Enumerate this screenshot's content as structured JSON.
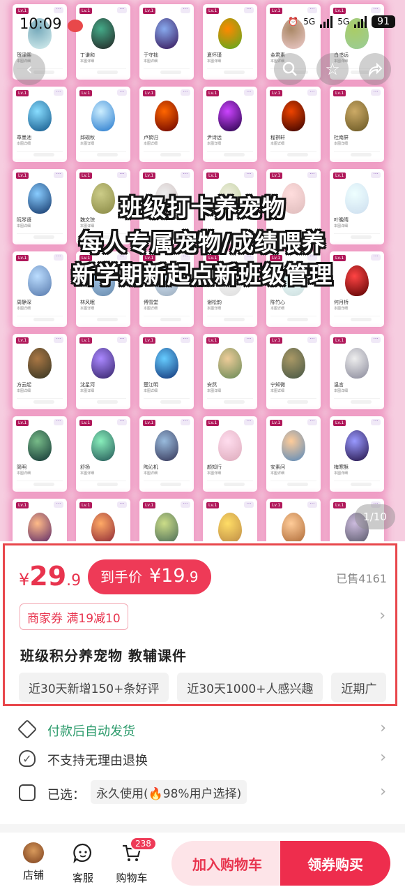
{
  "status_bar": {
    "time": "10:09",
    "net1": "5G",
    "net2": "5G",
    "battery": "91"
  },
  "gallery": {
    "overlay_lines": [
      "班级打卡养宠物",
      "每人专属宠物/成绩喂养",
      "新学期新起点新班级管理"
    ],
    "counter": "1/10",
    "card_level": "Lv.1",
    "card_subtitle": "本图详细",
    "names": [
      "贺泽熙",
      "丁谦和",
      "于守拙",
      "夏怀瑾",
      "金君素",
      "白书远",
      "章墨池",
      "邱砚秋",
      "卢鹤归",
      "尹诗远",
      "程祺轩",
      "杜南屏",
      "阮琴语",
      "魏文琮",
      "",
      "",
      "",
      "叶晚晴",
      "周静深",
      "林风眠",
      "傅雪堂",
      "谢松韵",
      "陈竹心",
      "何月桥",
      "方云起",
      "沈星河",
      "楚江明",
      "安然",
      "宁知微",
      "温言",
      "简明",
      "舒扬",
      "陶沁机",
      "颜知行",
      "安素问",
      "梅寒酥",
      "",
      "",
      "",
      "",
      "",
      ""
    ]
  },
  "product": {
    "currency": "¥",
    "price_int": "29",
    "price_dec": ".9",
    "deal_label": "到手价",
    "deal_price": "¥19",
    "deal_dec": ".9",
    "sold": "已售4161",
    "coupon": "商家券 满19减10",
    "title": "班级积分养宠物 教辅课件",
    "tags": [
      "近30天新增150+条好评",
      "近30天1000+人感兴趣",
      "近期广"
    ]
  },
  "info": {
    "shipping": "付款后自动发货",
    "refund": "不支持无理由退换",
    "chosen_label": "已选：",
    "chosen_value": "永久使用(🔥98%用户选择)"
  },
  "bottom_bar": {
    "shop": "店铺",
    "service": "客服",
    "cart": "购物车",
    "cart_count": "238",
    "add_cart": "加入购物车",
    "buy": "领券购买"
  },
  "colors": {
    "accent": "#ee2d4d",
    "hero_bg": "#f6cde0",
    "panel_border": "#e8474c",
    "shipping_green": "#2a9a6a"
  },
  "icons": {
    "back": "back-icon",
    "search": "search-icon",
    "favorite": "star-icon",
    "share": "share-icon"
  }
}
